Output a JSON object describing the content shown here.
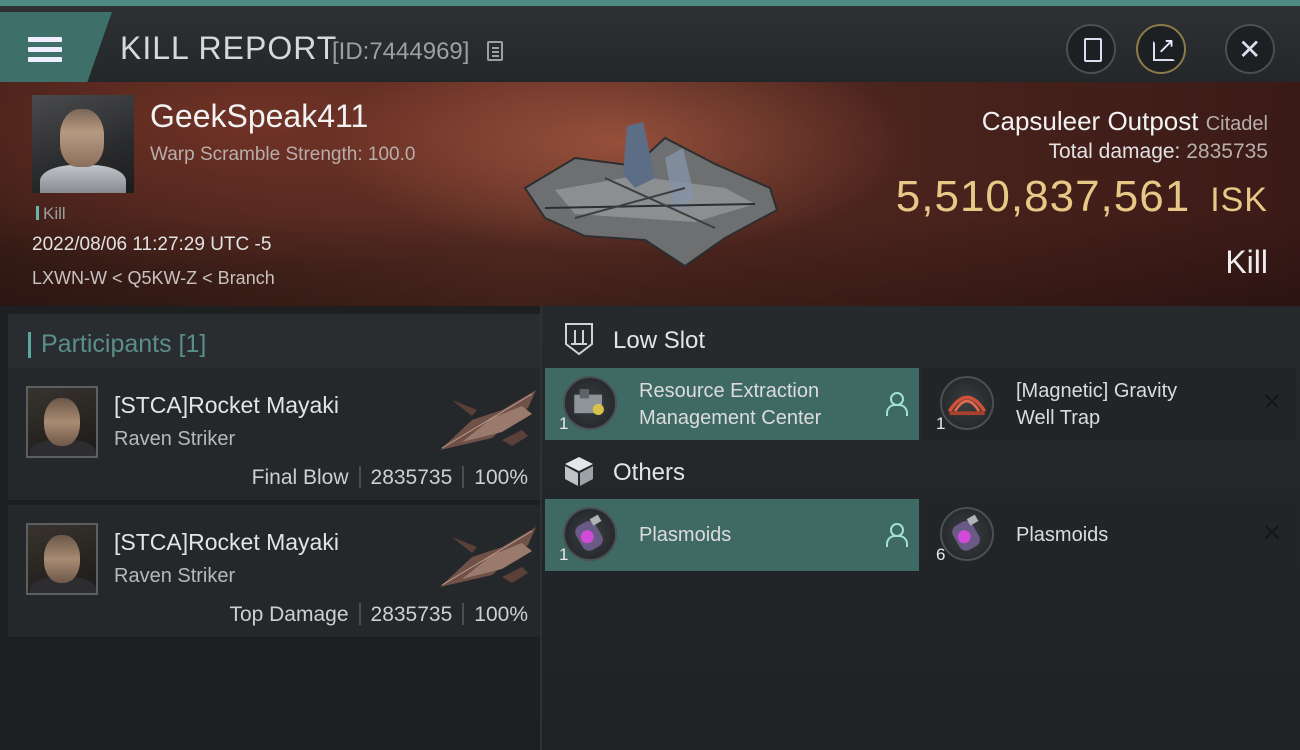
{
  "header": {
    "title": "KILL REPORT",
    "report_id": "[ID:7444969]"
  },
  "victim": {
    "name": "GeekSpeak411",
    "subtitle": "Warp Scramble Strength: 100.0",
    "tag": "Kill",
    "datetime": "2022/08/06 11:27:29 UTC -5",
    "location": "LXWN-W < Q5KW-Z < Branch"
  },
  "target": {
    "name": "Capsuleer Outpost",
    "class": "Citadel",
    "total_damage_label": "Total damage:",
    "total_damage": "2835735",
    "value": "5,510,837,561",
    "currency": "ISK",
    "result": "Kill"
  },
  "participants": {
    "header": "Participants [1]",
    "items": [
      {
        "name": "[STCA]Rocket Mayaki",
        "ship": "Raven Striker",
        "role": "Final Blow",
        "damage": "2835735",
        "percent": "100%"
      },
      {
        "name": "[STCA]Rocket Mayaki",
        "ship": "Raven Striker",
        "role": "Top Damage",
        "damage": "2835735",
        "percent": "100%"
      }
    ]
  },
  "fitting": {
    "low_slot_label": "Low Slot",
    "others_label": "Others",
    "low_slot_items": [
      {
        "name_line1": "Resource Extraction",
        "name_line2": "Management Center",
        "qty": "1",
        "state": "destroyed"
      },
      {
        "name_line1": "[Magnetic] Gravity",
        "name_line2": "Well Trap",
        "qty": "1",
        "state": "dropped"
      }
    ],
    "other_items": [
      {
        "name": "Plasmoids",
        "qty": "1",
        "state": "destroyed"
      },
      {
        "name": "Plasmoids",
        "qty": "6",
        "state": "dropped"
      }
    ]
  },
  "icons": {
    "menu": "hamburger-menu-icon",
    "copy": "copy-icon",
    "report": "clipboard-icon",
    "share": "share-icon",
    "close": "close-icon",
    "low_slot": "low-slot-icon",
    "others": "cargo-box-icon",
    "destroyed": "person-icon",
    "dropped": "x-icon"
  },
  "colors": {
    "accent": "#3f6a64",
    "isk_gold": "#e8c886",
    "hero_red": "#552b22"
  }
}
